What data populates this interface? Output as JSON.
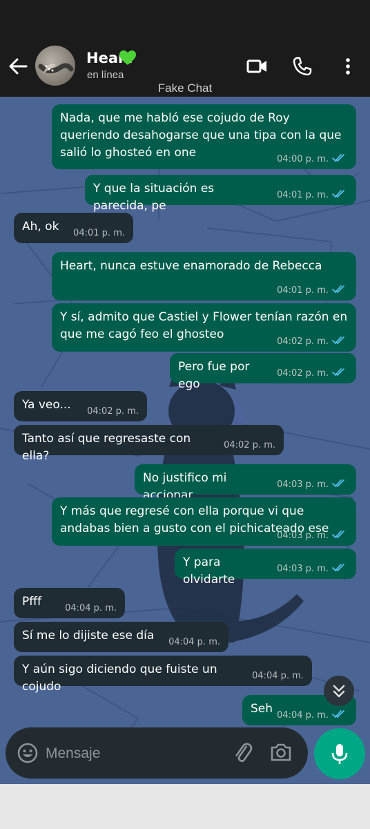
{
  "header": {
    "contact_name": "Heart",
    "status": "en línea",
    "watermark": "Fake Chat"
  },
  "messages": [
    {
      "dir": "out",
      "text": "Nada, que me habló ese cojudo de Roy queriendo desahogarse que una tipa con la que salió lo ghosteó en one",
      "time": "04:00 p. m."
    },
    {
      "dir": "out",
      "text": "Y que la situación es parecida, pe",
      "time": "04:01 p. m."
    },
    {
      "dir": "in",
      "text": "Ah, ok",
      "time": "04:01 p. m."
    },
    {
      "dir": "out",
      "text": "Heart, nunca estuve enamorado de Rebecca",
      "time": "04:01 p. m."
    },
    {
      "dir": "out",
      "text": "Y sí, admito que Castiel y Flower tenían razón en que me cagó feo el ghosteo",
      "time": "04:02 p. m."
    },
    {
      "dir": "out",
      "text": "Pero fue por ego",
      "time": "04:02 p. m."
    },
    {
      "dir": "in",
      "text": "Ya veo...",
      "time": "04:02 p. m."
    },
    {
      "dir": "in",
      "text": "Tanto así que regresaste con ella?",
      "time": "04:02 p. m."
    },
    {
      "dir": "out",
      "text": "No justifico mi accionar",
      "time": "04:03 p. m."
    },
    {
      "dir": "out",
      "text": "Y más que regresé con ella porque vi que andabas bien a gusto con el pichicateado ese",
      "time": "04:03 p. m."
    },
    {
      "dir": "out",
      "text": "Y para olvidarte",
      "time": "04:03 p. m."
    },
    {
      "dir": "in",
      "text": "Pfff",
      "time": "04:04 p. m."
    },
    {
      "dir": "in",
      "text": "Sí me lo dijiste ese día",
      "time": "04:04 p. m."
    },
    {
      "dir": "in",
      "text": "Y aún sigo diciendo que fuiste un cojudo",
      "time": "04:04 p. m."
    },
    {
      "dir": "out",
      "text": "Seh",
      "time": "04:04 p. m."
    }
  ],
  "composer": {
    "placeholder": "Mensaje"
  },
  "icons": {
    "back": "arrow-left-icon",
    "video": "video-call-icon",
    "call": "phone-icon",
    "menu": "more-vert-icon",
    "emoji": "emoji-icon",
    "attach": "paperclip-icon",
    "camera": "camera-icon",
    "mic": "microphone-icon",
    "scroll": "chevrons-down-icon",
    "read": "double-check-icon"
  },
  "colors": {
    "outgoing_bubble": "#005d4b",
    "incoming_bubble": "#1f2c34",
    "read_ticks": "#53bdeb",
    "mic_button": "#00a785",
    "heart_emoji": "#4cd137"
  }
}
